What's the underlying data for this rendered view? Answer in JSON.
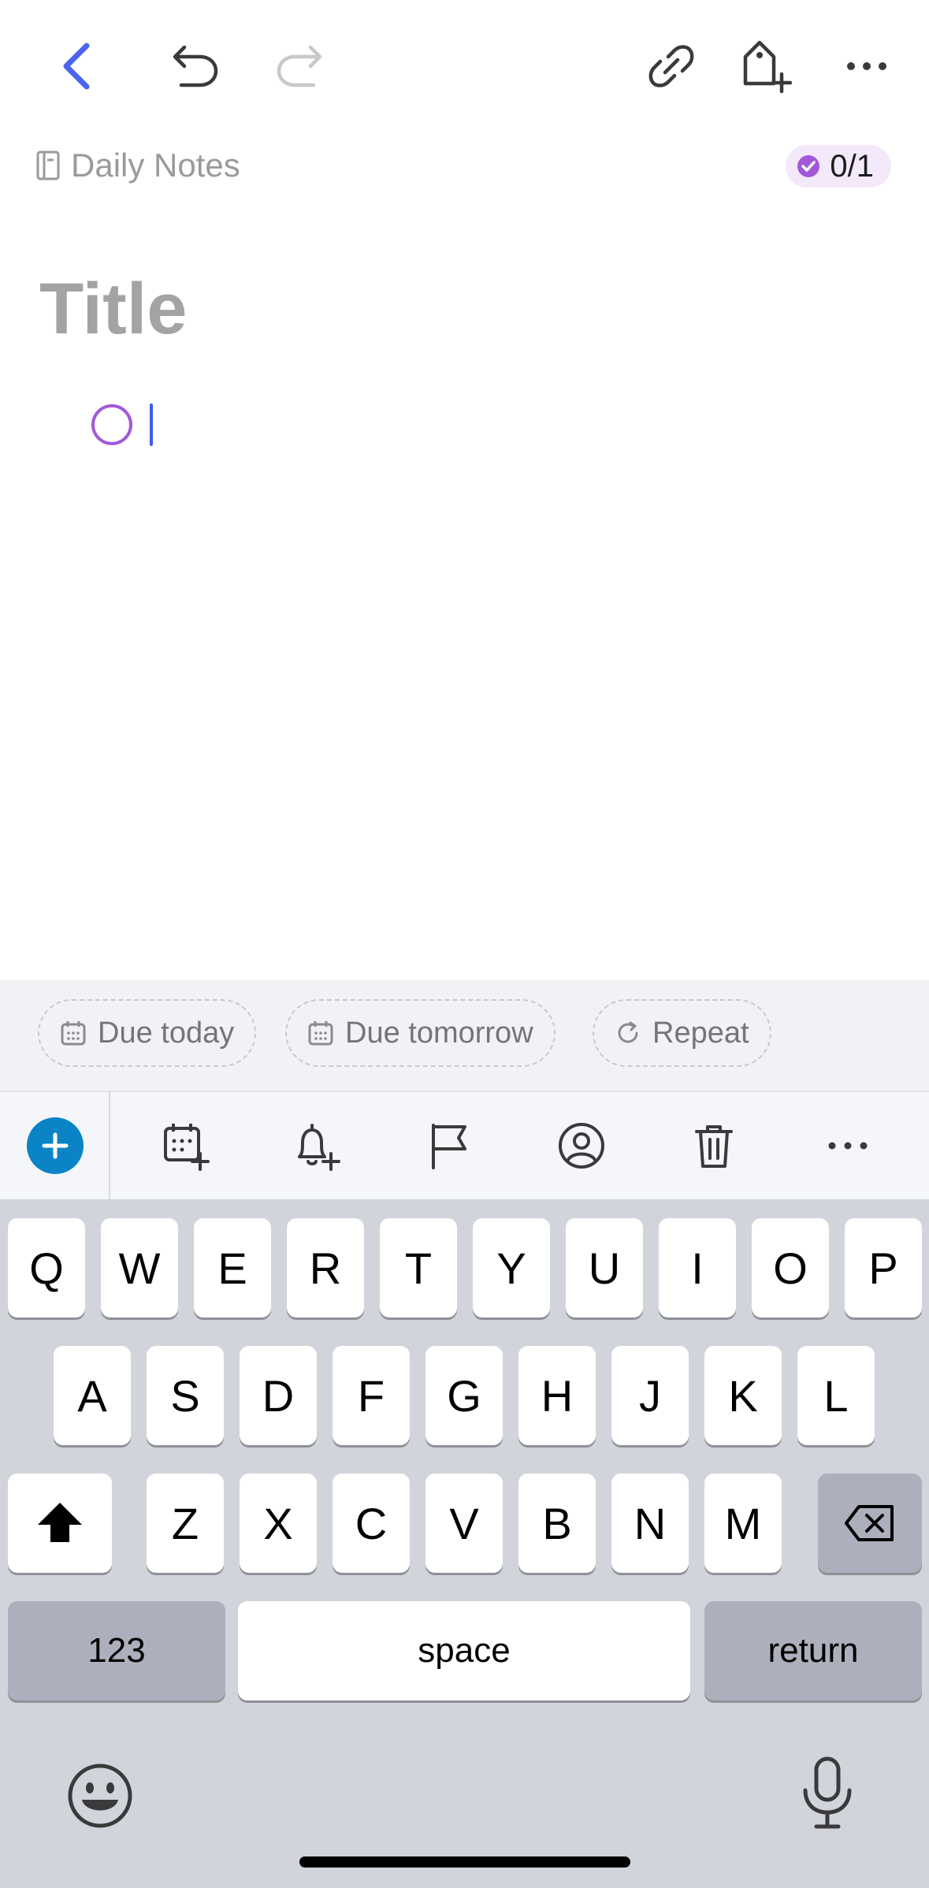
{
  "breadcrumb": {
    "label": "Daily Notes"
  },
  "progress": {
    "text": "0/1",
    "done": 0,
    "total": 1
  },
  "note": {
    "title_placeholder": "Title"
  },
  "chips": [
    {
      "label": "Due today",
      "icon": "calendar-icon"
    },
    {
      "label": "Due tomorrow",
      "icon": "calendar-icon"
    },
    {
      "label": "Repeat",
      "icon": "repeat-icon"
    }
  ],
  "keyboard": {
    "row1": [
      "Q",
      "W",
      "E",
      "R",
      "T",
      "Y",
      "U",
      "I",
      "O",
      "P"
    ],
    "row2": [
      "A",
      "S",
      "D",
      "F",
      "G",
      "H",
      "J",
      "K",
      "L"
    ],
    "row3": [
      "Z",
      "X",
      "C",
      "V",
      "B",
      "N",
      "M"
    ],
    "numbers_label": "123",
    "space_label": "space",
    "return_label": "return"
  },
  "colors": {
    "accent_blue": "#3a5cf2",
    "task_purple": "#a259d9",
    "add_button_blue": "#0a84c6",
    "keyboard_bg": "#d1d4db"
  }
}
